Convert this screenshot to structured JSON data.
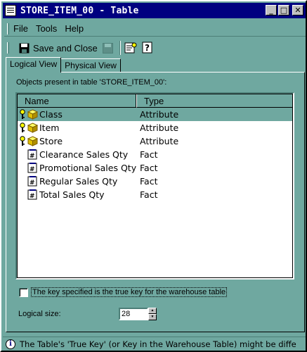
{
  "window": {
    "title": "STORE_ITEM_00 - Table"
  },
  "title_buttons": {
    "minimize": "_",
    "maximize": "□",
    "close": "✕"
  },
  "menu": [
    {
      "label": "File"
    },
    {
      "label": "Tools"
    },
    {
      "label": "Help"
    }
  ],
  "toolbar": {
    "save_close_label": "Save and Close"
  },
  "tabs": [
    {
      "label": "Logical View",
      "active": true
    },
    {
      "label": "Physical View",
      "active": false
    }
  ],
  "objects_label": "Objects present in table 'STORE_ITEM_00':",
  "list": {
    "columns": [
      "Name",
      "Type"
    ],
    "rows": [
      {
        "name": "Class",
        "type": "Attribute",
        "key": true,
        "icon": "attribute-cube-icon",
        "selected": true
      },
      {
        "name": "Item",
        "type": "Attribute",
        "key": true,
        "icon": "attribute-cube-icon",
        "selected": false
      },
      {
        "name": "Store",
        "type": "Attribute",
        "key": true,
        "icon": "attribute-cube-icon",
        "selected": false
      },
      {
        "name": "Clearance Sales Qty",
        "type": "Fact",
        "key": false,
        "icon": "fact-icon",
        "selected": false
      },
      {
        "name": "Promotional Sales Qty",
        "type": "Fact",
        "key": false,
        "icon": "fact-icon",
        "selected": false
      },
      {
        "name": "Regular Sales Qty",
        "type": "Fact",
        "key": false,
        "icon": "fact-icon",
        "selected": false
      },
      {
        "name": "Total Sales Qty",
        "type": "Fact",
        "key": false,
        "icon": "fact-icon",
        "selected": false
      }
    ]
  },
  "true_key_checkbox": {
    "label": "The key specified is the true key for the warehouse table",
    "checked": false
  },
  "logical_size": {
    "label": "Logical size:",
    "value": "28"
  },
  "status": {
    "text": "The Table's 'True Key' (or Key in the Warehouse Table) might be diffe"
  },
  "colors": {
    "background": "#6fa8a0",
    "titlebar": "#000080",
    "selection": "#6fa8a0"
  }
}
